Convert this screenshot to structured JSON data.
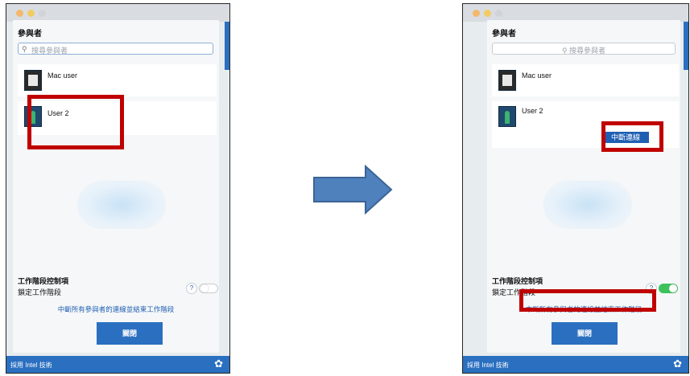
{
  "common": {
    "participants_title": "參與者",
    "search_placeholder": "搜尋參與者",
    "users": [
      {
        "name": "Mac user"
      },
      {
        "name": "User 2"
      }
    ],
    "session_controls_title": "工作階段控制項",
    "lock_session_label": "鎖定工作階段",
    "help_symbol": "?",
    "end_all_link": "中斷所有參與者的連線並結束工作階段",
    "close_button": "關閉",
    "footer_text": "採用 Intel 技術",
    "gear_symbol": "✿",
    "search_symbol": "⚲"
  },
  "before": {
    "lock_toggle": "off"
  },
  "after": {
    "disconnect_button": "中斷連線",
    "lock_toggle": "on"
  },
  "colors": {
    "accent_blue": "#2a6fc0",
    "highlight_red": "#c00000",
    "toggle_on_green": "#3cc25a",
    "arrow_fill": "#4f81bd"
  }
}
